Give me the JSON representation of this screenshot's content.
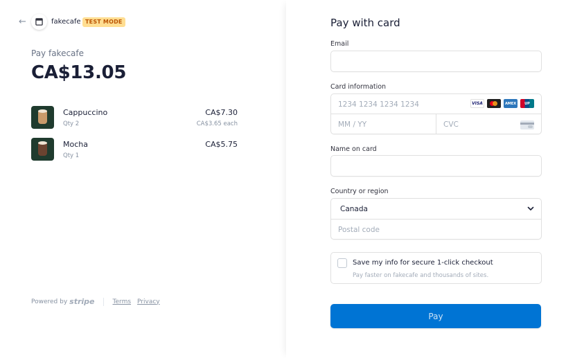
{
  "header": {
    "merchant_name": "fakecafe",
    "test_mode_label": "TEST MODE"
  },
  "summary": {
    "pay_label": "Pay fakecafe",
    "total": "CA$13.05",
    "items": [
      {
        "name": "Cappuccino",
        "qty": "Qty 2",
        "price": "CA$7.30",
        "each": "CA$3.65 each"
      },
      {
        "name": "Mocha",
        "qty": "Qty 1",
        "price": "CA$5.75",
        "each": ""
      }
    ]
  },
  "footer": {
    "powered_by": "Powered by",
    "stripe": "stripe",
    "terms": "Terms",
    "privacy": "Privacy"
  },
  "form": {
    "title": "Pay with card",
    "email_label": "Email",
    "email_value": "",
    "card_label": "Card information",
    "card_number_placeholder": "1234 1234 1234 1234",
    "expiry_placeholder": "MM / YY",
    "cvc_placeholder": "CVC",
    "card_brands": [
      "VISA",
      "mastercard",
      "AMEX",
      "UnionPay"
    ],
    "name_label": "Name on card",
    "name_value": "",
    "country_label": "Country or region",
    "country_value": "Canada",
    "postal_placeholder": "Postal code",
    "save_title": "Save my info for secure 1-click checkout",
    "save_subtitle": "Pay faster on fakecafe and thousands of sites.",
    "pay_button": "Pay"
  },
  "colors": {
    "accent": "#0074d4",
    "test_badge_bg": "#ffde92",
    "test_badge_text": "#bb5504"
  }
}
